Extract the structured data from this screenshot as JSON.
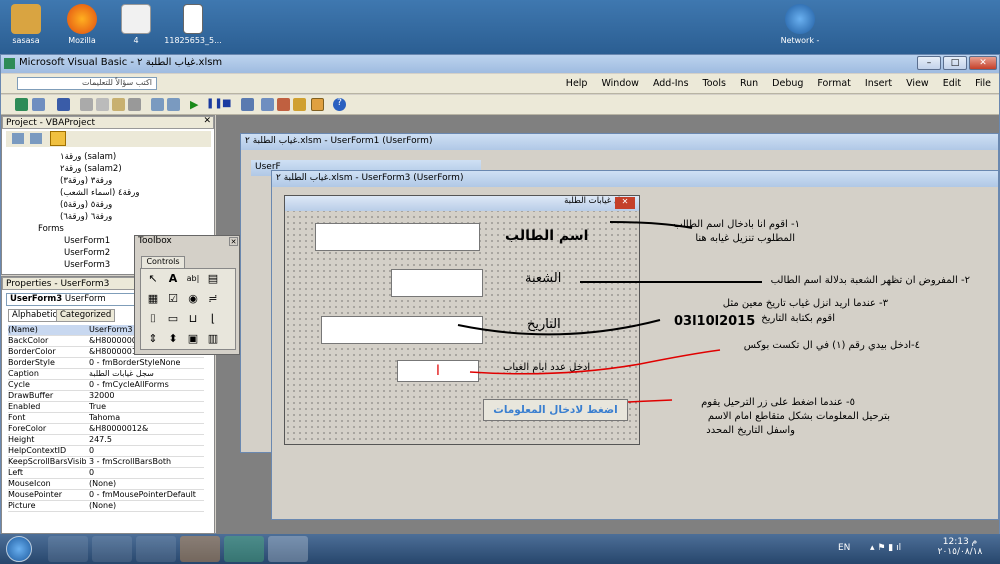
{
  "desktop": {
    "icons": [
      {
        "label": "sasasa"
      },
      {
        "label": "Mozilla"
      },
      {
        "label": "4"
      },
      {
        "label": "11825653_5..."
      },
      {
        "label": "Network -"
      }
    ]
  },
  "vbe": {
    "title": "Microsoft Visual Basic - غياب الطلبة ٢.xlsm",
    "help_placeholder": "اكتب سؤالاً للتعليمات",
    "menus": [
      "Help",
      "Window",
      "Add-Ins",
      "Tools",
      "Run",
      "Debug",
      "Format",
      "Insert",
      "View",
      "Edit",
      "File"
    ]
  },
  "project": {
    "title": "Project - VBAProject",
    "items": [
      "ورقة١ (salam)",
      "ورقة٢ (salam2)",
      "ورقة٣ (ورقة٣)",
      "ورقة٤ (اسماء الشعب)",
      "ورقة٥ (ورقة٥)",
      "ورقة٦ (ورقة٦)",
      "Forms",
      "UserForm1",
      "UserForm2",
      "UserForm3"
    ]
  },
  "properties": {
    "title": "Properties - UserForm3",
    "object": "UserForm3",
    "object_type": "UserForm",
    "tab_alpha": "Alphabetic",
    "tab_cat": "Categorized",
    "rows": [
      {
        "k": "(Name)",
        "v": "UserForm3"
      },
      {
        "k": "BackColor",
        "v": "&H8000000F&"
      },
      {
        "k": "BorderColor",
        "v": "&H80000012&"
      },
      {
        "k": "BorderStyle",
        "v": "0 - fmBorderStyleNone"
      },
      {
        "k": "Caption",
        "v": "سجل غيابات الطلبة"
      },
      {
        "k": "Cycle",
        "v": "0 - fmCycleAllForms"
      },
      {
        "k": "DrawBuffer",
        "v": "32000"
      },
      {
        "k": "Enabled",
        "v": "True"
      },
      {
        "k": "Font",
        "v": "Tahoma"
      },
      {
        "k": "ForeColor",
        "v": "&H80000012&"
      },
      {
        "k": "Height",
        "v": "247.5"
      },
      {
        "k": "HelpContextID",
        "v": "0"
      },
      {
        "k": "KeepScrollBarsVisible",
        "v": "3 - fmScrollBarsBoth"
      },
      {
        "k": "Left",
        "v": "0"
      },
      {
        "k": "MouseIcon",
        "v": "(None)"
      },
      {
        "k": "MousePointer",
        "v": "0 - fmMousePointerDefault"
      },
      {
        "k": "Picture",
        "v": "(None)"
      }
    ]
  },
  "toolbox": {
    "title": "Toolbox",
    "tab": "Controls"
  },
  "windows": {
    "uf1_title": "غياب الطلبة ٢.xlsm - UserForm1 (UserForm)",
    "uf2_title": "UserF",
    "uf3_title": "غياب الطلبة ٢.xlsm - UserForm3 (UserForm)"
  },
  "form": {
    "caption": "سجل غيابات الطلبة",
    "label_name": "اسم الطالب",
    "label_section": "الشعبة",
    "label_date": "التاريخ",
    "label_days": "ادخل عدد ايام الغياب",
    "days_value": "ا",
    "submit": "اضغط لادخال المعلومات"
  },
  "annotations": {
    "a1_1": "١- اقوم انا بادخال اسم الطالب",
    "a1_2": "المطلوب تنزيل غيابه هنا",
    "a2": "٢- المفروض ان تظهر الشعبة  بدلالة اسم الطالب",
    "a3_1": "٣- عندما اريد  انزل  غياب تاريخ معين  مثل",
    "a3_2": "اقوم بكتابة التاريخ",
    "a3_date": "03l10l2015",
    "a4": "٤-ادخل بيدي رقم (١) في ال تكست بوكس",
    "a5_1": "٥- عندما اضغط على زر  الترحيل يقوم",
    "a5_2": "بترحيل المعلومات بشكل متقاطع امام الاسم",
    "a5_3": "واسفل التاريخ المحدد"
  },
  "taskbar": {
    "lang": "EN",
    "time": "12:13 م",
    "date": "٢٠١٥/٠٨/١٨"
  },
  "colors": {
    "red": "#e00000",
    "blue_button": "#3a7fd0"
  }
}
